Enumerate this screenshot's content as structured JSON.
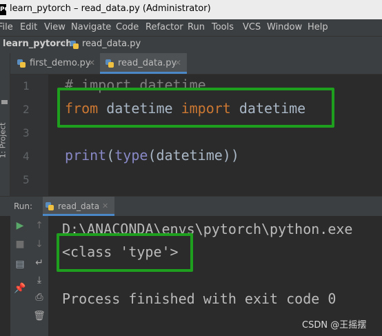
{
  "window": {
    "title": "learn_pytorch – read_data.py (Administrator)"
  },
  "menu": [
    "File",
    "Edit",
    "View",
    "Navigate",
    "Code",
    "Refactor",
    "Run",
    "Tools",
    "VCS",
    "Window",
    "Help"
  ],
  "navbar": {
    "project": "learn_pytorch",
    "file": "read_data.py"
  },
  "sidebar": {
    "project_tab": "1: Project"
  },
  "tabs": [
    {
      "label": "first_demo.py",
      "active": false
    },
    {
      "label": "read_data.py",
      "active": true
    }
  ],
  "editor": {
    "line_numbers": [
      "1",
      "2",
      "3",
      "4",
      "5"
    ],
    "line1": "# import datetime",
    "line2": {
      "kw1": "from",
      "mod": " datetime ",
      "kw2": "import",
      "name": " datetime"
    },
    "line4": {
      "fn": "print",
      "p1": "(",
      "fn2": "type",
      "rest": "(datetime))"
    }
  },
  "run_panel": {
    "label": "Run:",
    "tab_label": "read_data",
    "console": {
      "line1": "D:\\ANACONDA\\envs\\pytorch\\python.exe",
      "line2": "<class 'type'>",
      "line3": "Process finished with exit code 0"
    }
  },
  "watermark": "CSDN @王摇摆",
  "colors": {
    "highlight": "#1ea01e",
    "keyword": "#cc7832",
    "builtin": "#8888c6",
    "text": "#a9b7c6",
    "comment": "#808080"
  }
}
